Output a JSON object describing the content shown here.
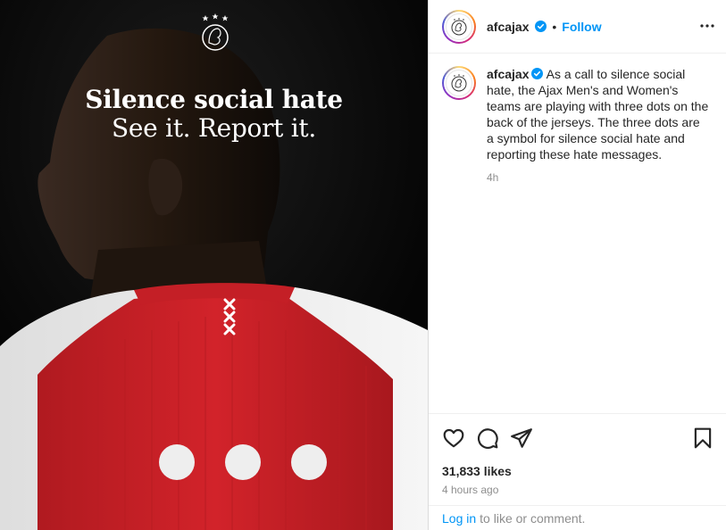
{
  "media": {
    "headline_line1": "Silence social hate",
    "headline_line2": "See it. Report it.",
    "logo_icon": "ajax-club-crest-icon",
    "colors": {
      "background": "#0b0b0b",
      "jersey_red": "#d2232a",
      "jersey_white": "#f2f2f2"
    }
  },
  "header": {
    "username": "afcajax",
    "separator": "•",
    "follow_label": "Follow",
    "more_icon": "more-options-icon"
  },
  "caption": {
    "username": "afcajax",
    "text": "As a call to silence social hate, the Ajax Men's and Women's teams are playing with three dots on the back of the jerseys. The three dots are a symbol for silence social hate and reporting these hate messages.",
    "time": "4h"
  },
  "actions": {
    "like_icon": "heart-icon",
    "comment_icon": "comment-icon",
    "share_icon": "share-icon",
    "save_icon": "bookmark-icon"
  },
  "stats": {
    "likes": "31,833 likes",
    "time_ago": "4 hours ago"
  },
  "login": {
    "link_label": "Log in",
    "suffix": "to like or comment."
  },
  "colors": {
    "accent": "#0095f6",
    "verified": "#0095f6",
    "muted": "#8e8e8e"
  }
}
